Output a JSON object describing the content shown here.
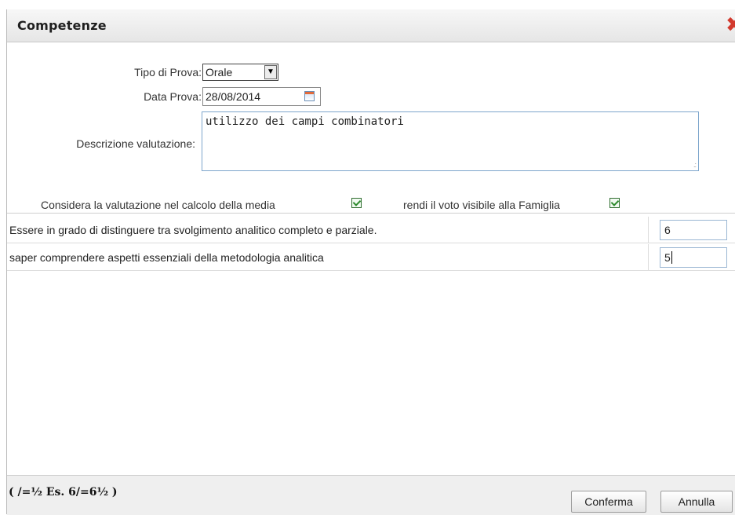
{
  "dialog": {
    "title": "Competenze",
    "close_icon": "close-icon"
  },
  "form": {
    "tipo_prova_label": "Tipo di Prova:",
    "tipo_prova_value": "Orale",
    "data_prova_label": "Data Prova:",
    "data_prova_value": "28/08/2014",
    "descrizione_label": "Descrizione valutazione:",
    "descrizione_value": "utilizzo dei campi combinatori",
    "media_label": "Considera la valutazione nel calcolo della media",
    "media_checked": true,
    "visibile_label": "rendi il voto visibile alla Famiglia",
    "visibile_checked": true
  },
  "competenze": [
    {
      "text": "Essere in grado di distinguere tra svolgimento analitico completo e parziale.",
      "score": "6"
    },
    {
      "text": "saper comprendere aspetti essenziali della metodologia analitica",
      "score": "5"
    }
  ],
  "footer": {
    "legend": "( /=½ Es. 6/=6½ )",
    "confirm_label": "Conferma",
    "cancel_label": "Annulla"
  },
  "colors": {
    "close_icon": "#d23a2e",
    "checkbox_check": "#2e8b2e"
  }
}
